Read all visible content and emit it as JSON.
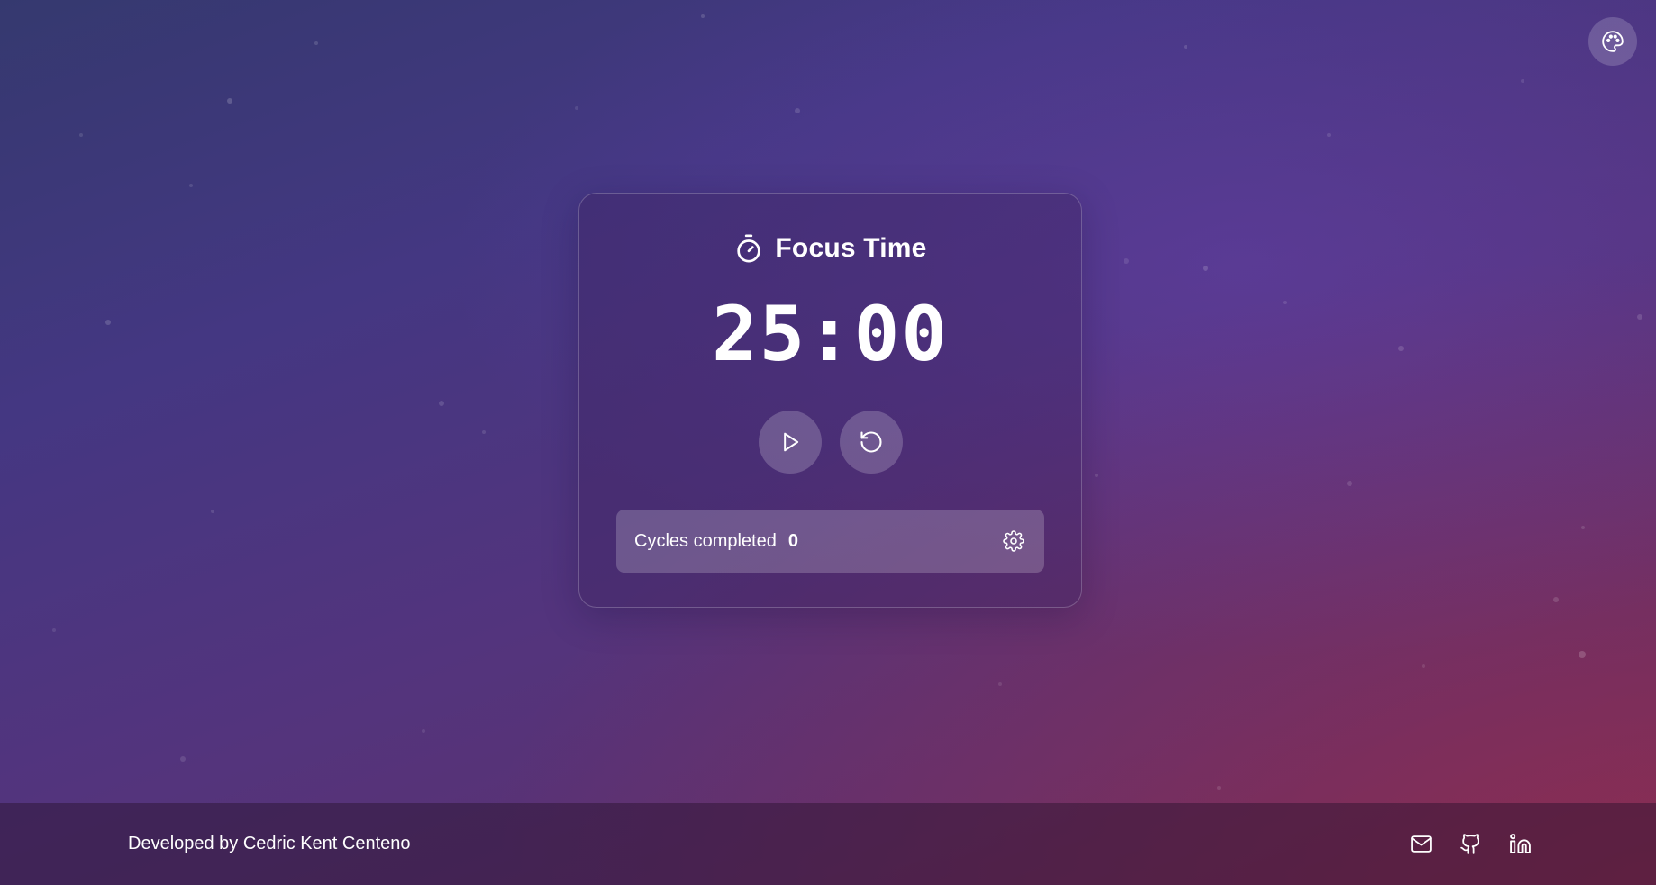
{
  "header": {
    "theme_icon": "palette-icon"
  },
  "timer_card": {
    "title": "Focus Time",
    "title_icon": "stopwatch-icon",
    "time": "25:00",
    "controls": {
      "play_icon": "play-icon",
      "reset_icon": "reset-icon"
    },
    "cycles": {
      "label": "Cycles completed",
      "count": "0",
      "settings_icon": "gear-icon"
    }
  },
  "footer": {
    "credit": "Developed by Cedric Kent Centeno",
    "links": [
      {
        "icon": "mail-icon"
      },
      {
        "icon": "github-icon"
      },
      {
        "icon": "linkedin-icon"
      }
    ]
  },
  "colors": {
    "background_top": "#35396f",
    "background_bottom": "#6a2c58",
    "text": "#ffffff"
  }
}
